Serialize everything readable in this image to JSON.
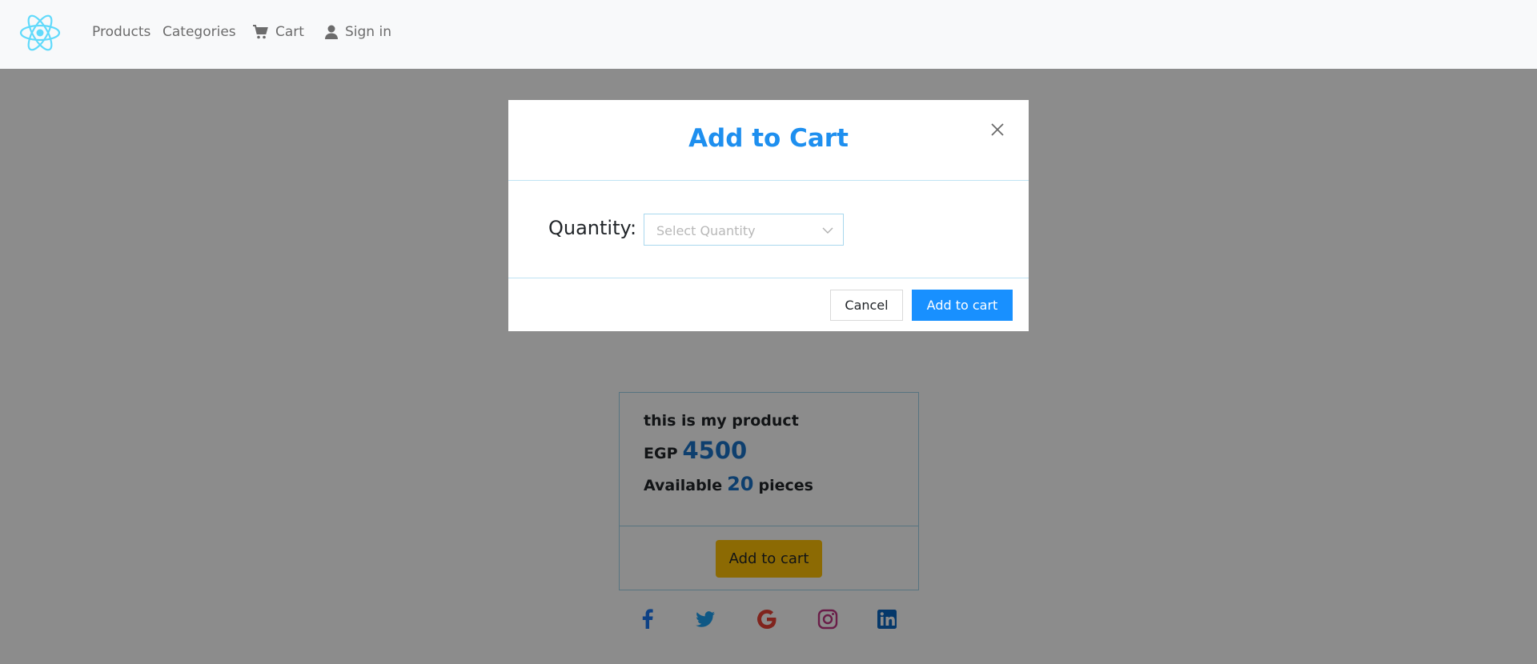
{
  "navbar": {
    "logo_icon": "react-atom-icon",
    "products_label": "Products",
    "categories_label": "Categories",
    "cart_label": "Cart",
    "signin_label": "Sign in"
  },
  "product": {
    "description": "this is my product",
    "currency": "EGP",
    "price": "4500",
    "available_prefix": "Available",
    "available_count": "20",
    "available_suffix": "pieces",
    "add_button_label": "Add to cart"
  },
  "social_icons": [
    "facebook-icon",
    "twitter-icon",
    "google-icon",
    "instagram-icon",
    "linkedin-icon"
  ],
  "modal": {
    "title": "Add to Cart",
    "quantity_label": "Quantity:",
    "quantity_placeholder": "Select Quantity",
    "cancel_label": "Cancel",
    "confirm_label": "Add to cart"
  },
  "colors": {
    "accent": "#1890ff",
    "title": "#1e8fef",
    "warning": "#ffc107",
    "navbar_bg": "#f8f9fa",
    "react": "#61dafb"
  }
}
